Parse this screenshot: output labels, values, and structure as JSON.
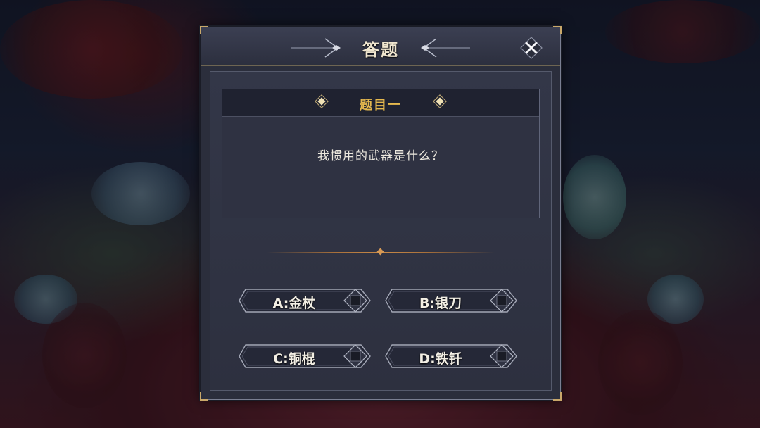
{
  "dialog": {
    "title": "答题",
    "close_icon": "close-x-icon"
  },
  "question": {
    "header": "题目一",
    "text": "我惯用的武器是什么？"
  },
  "options": [
    {
      "label": "A:金杖"
    },
    {
      "label": "B:银刀"
    },
    {
      "label": "C:铜棍"
    },
    {
      "label": "D:铁钎"
    }
  ],
  "colors": {
    "accent_gold": "#e6b94e",
    "panel_bg": "#2b2e3c",
    "frame_trim": "#c9a86a"
  }
}
